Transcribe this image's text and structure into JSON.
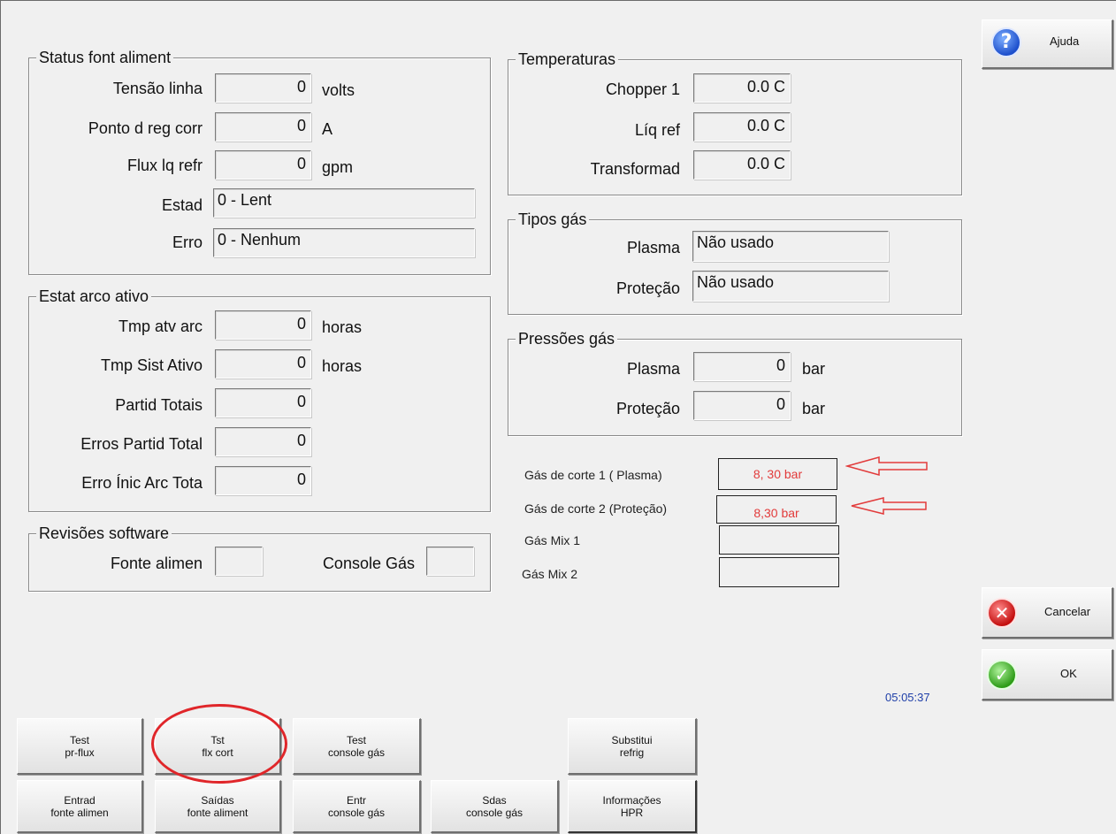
{
  "status_group": {
    "title": "Status font aliment",
    "line_voltage": {
      "label": "Tensão linha",
      "value": "0",
      "unit": "volts"
    },
    "current_setpoint": {
      "label": "Ponto d reg corr",
      "value": "0",
      "unit": "A"
    },
    "coolant_flow": {
      "label": "Flux lq refr",
      "value": "0",
      "unit": "gpm"
    },
    "state": {
      "label": "Estad",
      "value": "0 - Lent"
    },
    "error": {
      "label": "Erro",
      "value": "0 - Nenhum"
    }
  },
  "arc_group": {
    "title": "Estat arco ativo",
    "arc_on_time": {
      "label": "Tmp atv arc",
      "value": "0",
      "unit": "horas"
    },
    "system_on_time": {
      "label": "Tmp Sist Ativo",
      "value": "0",
      "unit": "horas"
    },
    "total_starts": {
      "label": "Partid Totais",
      "value": "0"
    },
    "total_start_errors": {
      "label": "Erros Partid Total",
      "value": "0"
    },
    "total_arc_start_errors": {
      "label": "Erro Ínic Arc Tota",
      "value": "0"
    }
  },
  "software_group": {
    "title": "Revisões software",
    "power_supply": {
      "label": "Fonte alimen",
      "value": ""
    },
    "gas_console": {
      "label": "Console Gás",
      "value": ""
    }
  },
  "temperature_group": {
    "title": "Temperaturas",
    "chopper": {
      "label": "Chopper 1",
      "value": "0.0 C"
    },
    "coolant": {
      "label": "Líq ref",
      "value": "0.0 C"
    },
    "transformer": {
      "label": "Transformad",
      "value": "0.0 C"
    }
  },
  "gas_types_group": {
    "title": "Tipos gás",
    "plasma": {
      "label": "Plasma",
      "value": "Não usado"
    },
    "shield": {
      "label": "Proteção",
      "value": "Não usado"
    }
  },
  "gas_pressure_group": {
    "title": "Pressões gás",
    "plasma": {
      "label": "Plasma",
      "value": "0",
      "unit": "bar"
    },
    "shield": {
      "label": "Proteção",
      "value": "0",
      "unit": "bar"
    }
  },
  "cut_gas": {
    "cut1": {
      "label": "Gás de corte 1 ( Plasma)",
      "value": "8, 30 bar"
    },
    "cut2": {
      "label": "Gás de corte 2 (Proteção)",
      "value": "8,30 bar"
    },
    "mix1": {
      "label": "Gás Mix 1",
      "value": ""
    },
    "mix2": {
      "label": "Gás Mix 2",
      "value": ""
    },
    "annotation_color": "#e23b3b"
  },
  "side_buttons": {
    "help": {
      "label": "Ajuda",
      "icon": "help-icon"
    },
    "cancel": {
      "label": "Cancelar",
      "icon": "cancel-icon"
    },
    "ok": {
      "label": "OK",
      "icon": "ok-icon"
    }
  },
  "clock": "05:05:37",
  "bottom_buttons": {
    "test_preflow": [
      "Test",
      "pr-flux"
    ],
    "test_cut_flow": [
      "Tst",
      "flx cort"
    ],
    "test_gas_console": [
      "Test",
      "console gás"
    ],
    "replace_coolant": [
      "Substitui",
      "refrig"
    ],
    "ps_inputs": [
      "Entrad",
      "fonte alimen"
    ],
    "ps_outputs": [
      "Saídas",
      "fonte aliment"
    ],
    "gas_console_inputs": [
      "Entr",
      "console gás"
    ],
    "gas_console_outputs": [
      "Sdas",
      "console gás"
    ],
    "hpr_info": [
      "Informações",
      "HPR"
    ]
  }
}
